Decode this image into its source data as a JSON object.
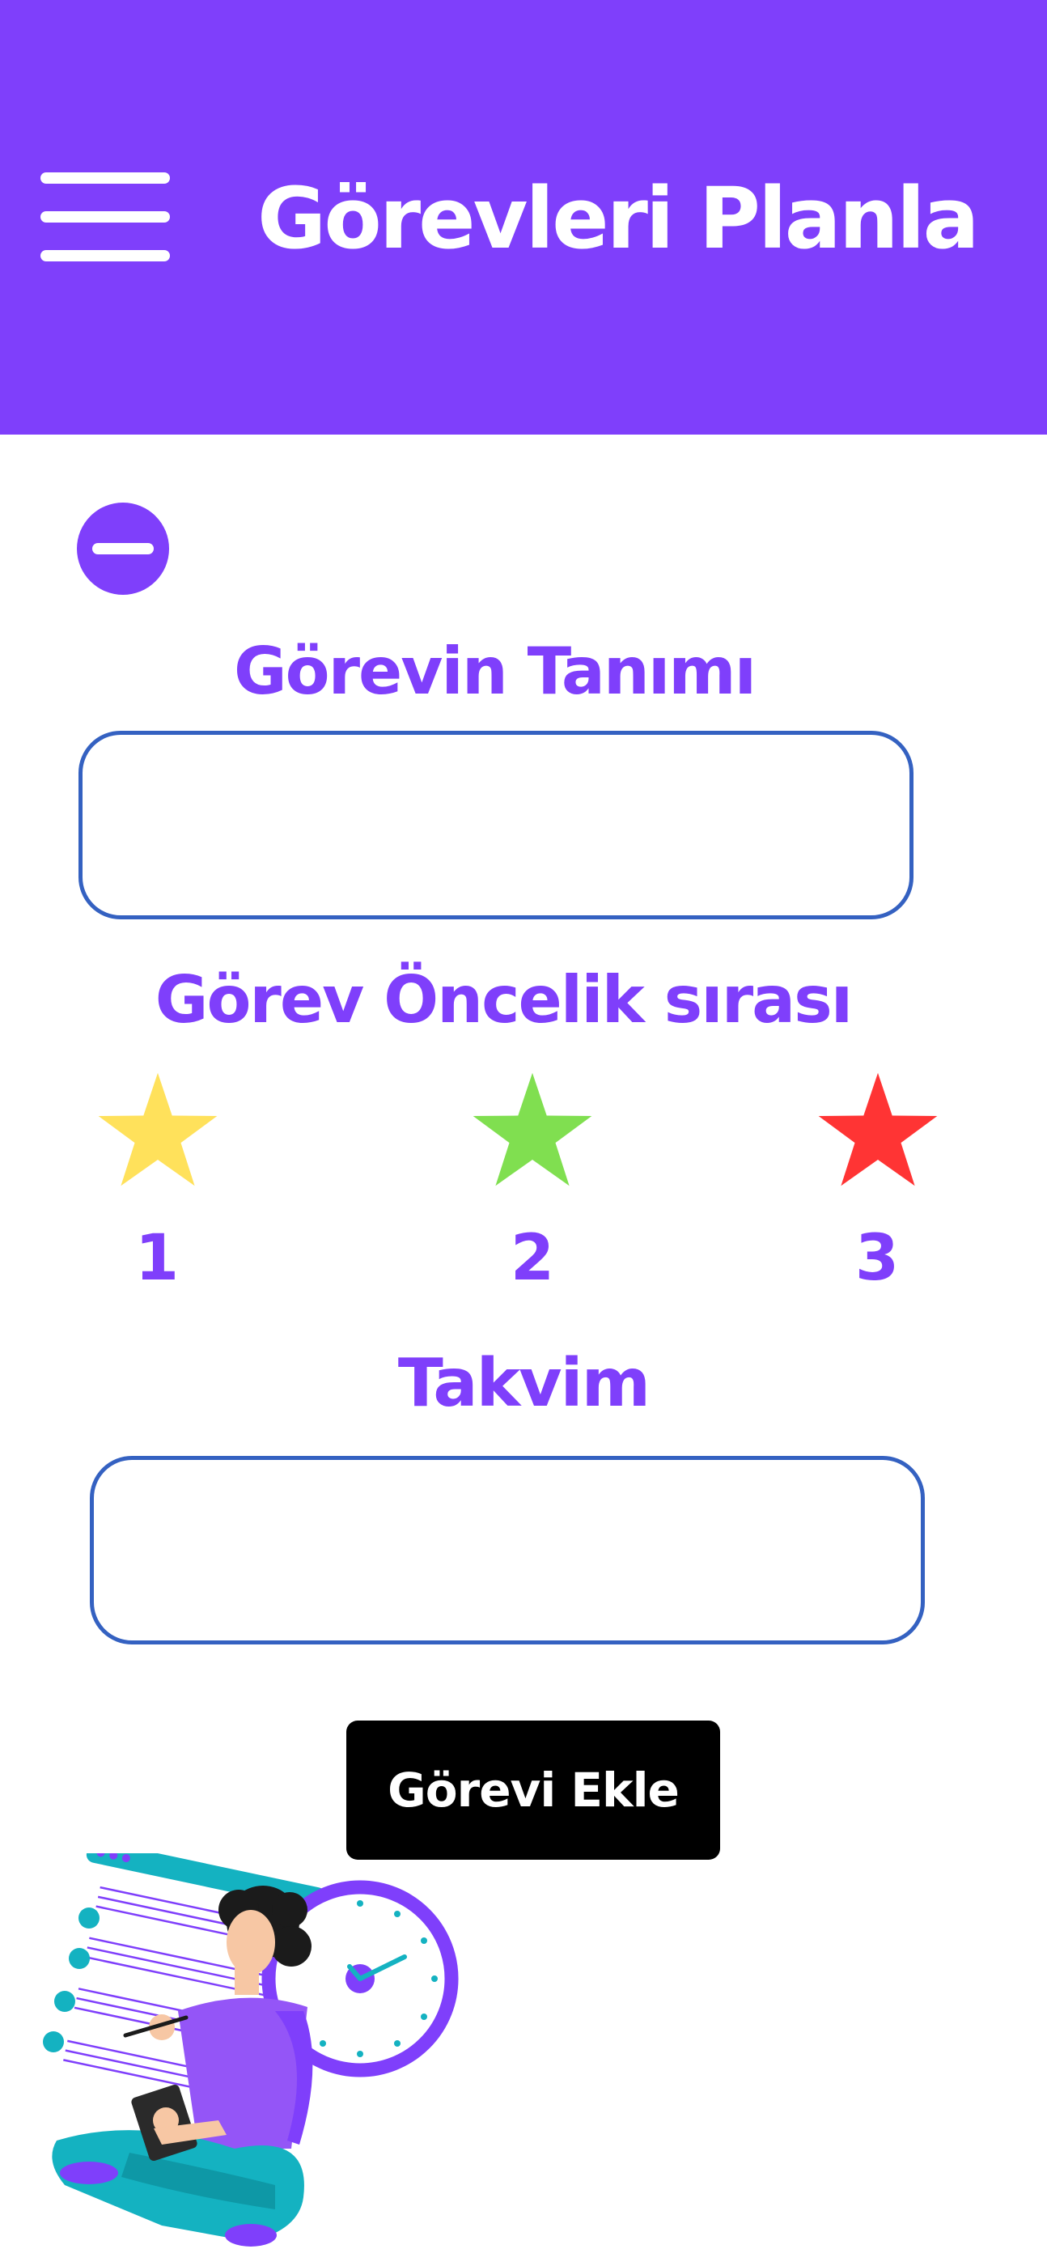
{
  "header": {
    "title": "Görevleri Planla",
    "menu_icon": "hamburger-menu-icon",
    "background_color": "#7f3ffb"
  },
  "form": {
    "remove_icon": "minus-circle-icon",
    "description_label": "Görevin Tanımı",
    "description_value": "",
    "priority_label": "Görev Öncelik sırası",
    "priorities": [
      {
        "value": "1",
        "color": "#ffe15b",
        "icon": "star-icon"
      },
      {
        "value": "2",
        "color": "#80df50",
        "icon": "star-icon"
      },
      {
        "value": "3",
        "color": "#ff3434",
        "icon": "star-icon"
      }
    ],
    "calendar_label": "Takvim",
    "calendar_value": "",
    "submit_label": "Görevi Ekle"
  },
  "theme": {
    "accent": "#7f3ffb",
    "field_border": "#3461c1",
    "button_bg": "#000000"
  },
  "illustration": {
    "icon": "person-with-clock-and-checklist-illustration"
  }
}
